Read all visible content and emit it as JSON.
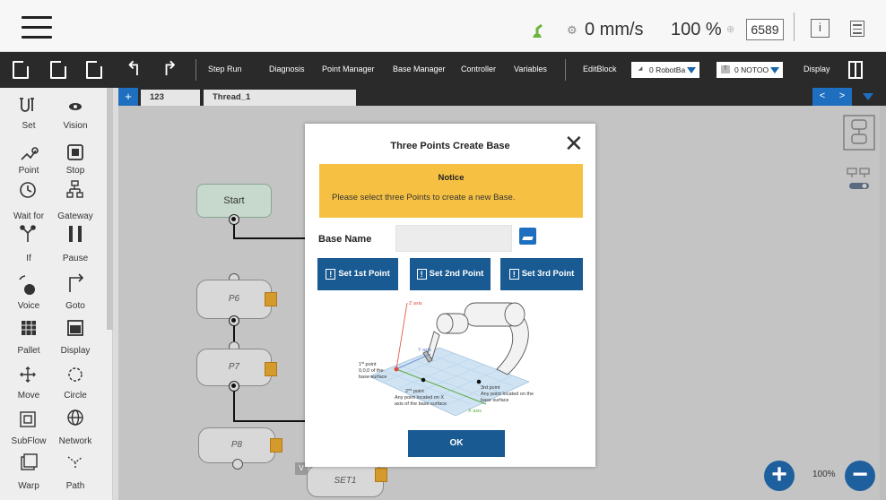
{
  "status_bar": {
    "speed_value": "0 mm/s",
    "speed_percent": "100 %",
    "robot_id": "6589",
    "icons": [
      "menu-icon",
      "robot-status-icon",
      "speed-icon",
      "link-icon",
      "info-icon",
      "log-icon"
    ]
  },
  "toolbar": {
    "items": [
      "Step Run",
      "Diagnosis",
      "Point Manager",
      "Base Manager",
      "Controller",
      "Variables"
    ],
    "editblock": "EditBlock",
    "robot_base": "0 RobotBa",
    "tool": "0 NOTOO",
    "tool_badge": "T",
    "display": "Display"
  },
  "palette": [
    {
      "label": "Set",
      "icon": "set-icon"
    },
    {
      "label": "Vision",
      "icon": "vision-icon"
    },
    {
      "label": "Point",
      "icon": "point-icon"
    },
    {
      "label": "Stop",
      "icon": "stop-icon"
    },
    {
      "label": "Wait for",
      "icon": "wait-for-icon"
    },
    {
      "label": "Gateway",
      "icon": "gateway-icon"
    },
    {
      "label": "If",
      "icon": "if-icon"
    },
    {
      "label": "Pause",
      "icon": "pause-icon"
    },
    {
      "label": "Voice",
      "icon": "voice-icon"
    },
    {
      "label": "Goto",
      "icon": "goto-icon"
    },
    {
      "label": "Pallet",
      "icon": "pallet-icon"
    },
    {
      "label": "Display",
      "icon": "display-icon"
    },
    {
      "label": "Move",
      "icon": "move-icon"
    },
    {
      "label": "Circle",
      "icon": "circle-icon"
    },
    {
      "label": "SubFlow",
      "icon": "subflow-icon"
    },
    {
      "label": "Network",
      "icon": "network-icon"
    },
    {
      "label": "Warp",
      "icon": "warp-icon"
    },
    {
      "label": "Path",
      "icon": "path-icon"
    }
  ],
  "tabs": {
    "plus": "+",
    "items": [
      "123",
      "Thread_1"
    ],
    "prev": "<",
    "next": ">"
  },
  "flow": {
    "start": "Start",
    "nodes": [
      "P6",
      "P7",
      "P8",
      "SET1"
    ],
    "badge_v": "V"
  },
  "zoom": {
    "percent": "100%",
    "plus": "+",
    "minus": "−"
  },
  "dialog": {
    "title": "Three Points Create Base",
    "close": "✕",
    "notice_title": "Notice",
    "notice_message": "Please select three Points to create a new Base.",
    "base_name_label": "Base Name",
    "base_name_value": "",
    "buttons": [
      "Set 1st Point",
      "Set 2nd Point",
      "Set 3rd Point"
    ],
    "ok": "OK",
    "diagram": {
      "z_axis": "Z axis",
      "y_axis": "Y axis",
      "x_axis": "X axis",
      "p1_a": "1",
      "p1_sup": "st",
      "p1_b": " point",
      "p1_l2": "0,0,0 of the",
      "p1_l3": "base surface",
      "p2_a": "2",
      "p2_sup": "nd",
      "p2_b": " point",
      "p2_l2": "Any point located on X",
      "p2_l3": "axis of the base surface",
      "p3_a": "3rd",
      "p3_b": " point",
      "p3_l2": "Any point located on the",
      "p3_l3": "base surface"
    }
  }
}
